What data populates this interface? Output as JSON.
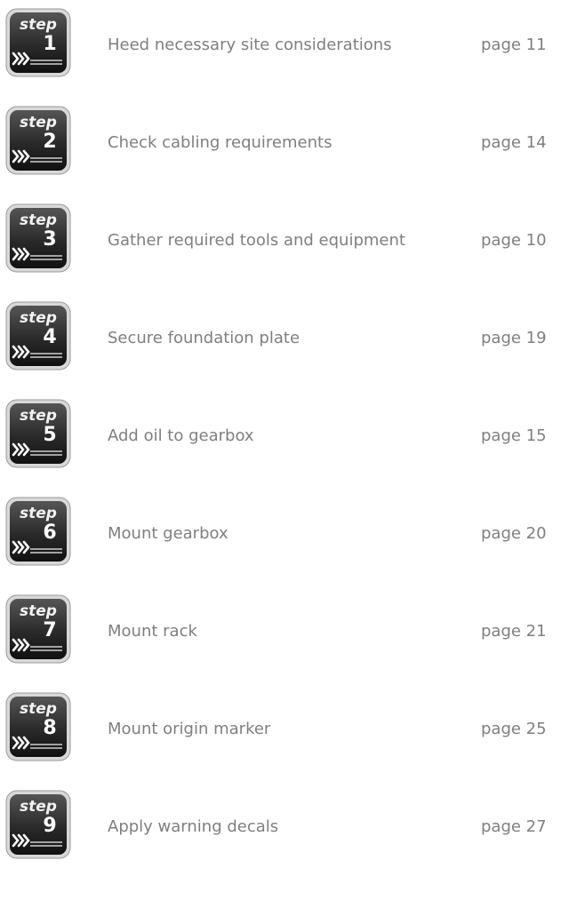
{
  "badge_word": "step",
  "steps": [
    {
      "number": "1",
      "description": "Heed necessary site considerations",
      "page": "page 11"
    },
    {
      "number": "2",
      "description": "Check cabling requirements",
      "page": "page 14"
    },
    {
      "number": "3",
      "description": "Gather required tools and equipment",
      "page": "page 10"
    },
    {
      "number": "4",
      "description": "Secure foundation plate",
      "page": "page 19"
    },
    {
      "number": "5",
      "description": "Add oil to gearbox",
      "page": "page 15"
    },
    {
      "number": "6",
      "description": "Mount gearbox",
      "page": "page 20"
    },
    {
      "number": "7",
      "description": "Mount rack",
      "page": "page 21"
    },
    {
      "number": "8",
      "description": "Mount origin marker",
      "page": "page 25"
    },
    {
      "number": "9",
      "description": "Apply warning decals",
      "page": "page 27"
    }
  ],
  "colors": {
    "text": "#7f7f7f",
    "badge_dark": "#2a2a2a",
    "badge_mid": "#555555",
    "badge_light": "#d8d8d8"
  }
}
